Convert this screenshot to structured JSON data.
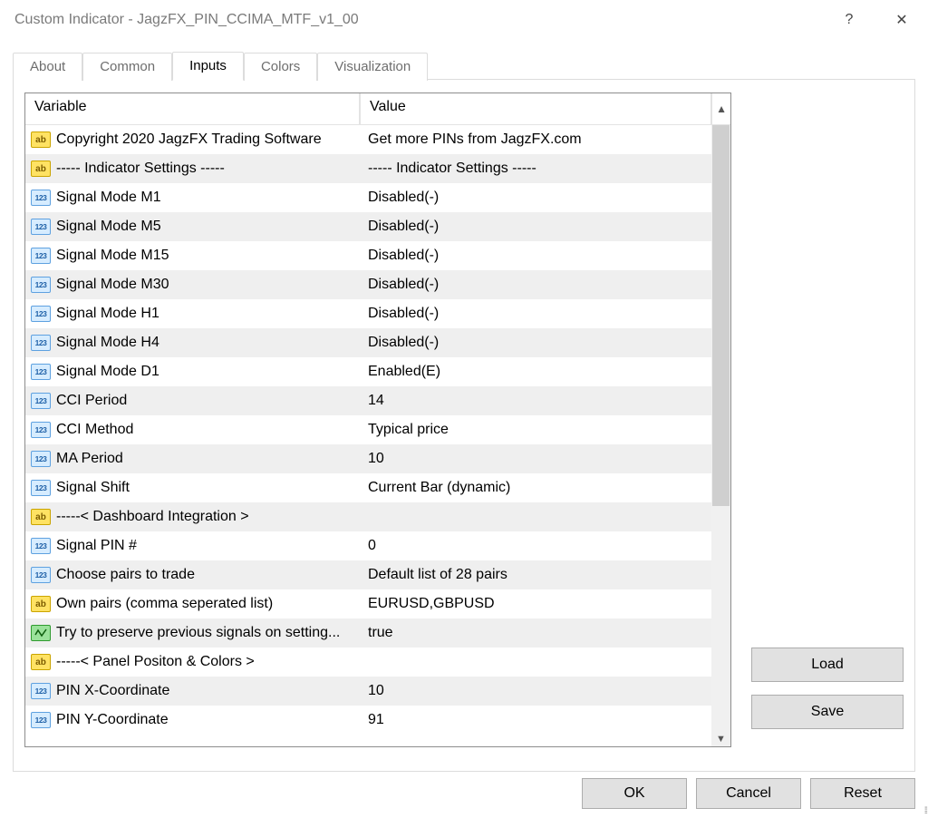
{
  "window": {
    "title": "Custom Indicator - JagzFX_PIN_CCIMA_MTF_v1_00",
    "help_glyph": "?",
    "close_glyph": "✕"
  },
  "tabs": {
    "about": "About",
    "common": "Common",
    "inputs": "Inputs",
    "colors": "Colors",
    "visualization": "Visualization"
  },
  "headers": {
    "variable": "Variable",
    "value": "Value"
  },
  "buttons": {
    "load": "Load",
    "save": "Save",
    "ok": "OK",
    "cancel": "Cancel",
    "reset": "Reset"
  },
  "rows": [
    {
      "icon": "ab",
      "alt": false,
      "variable": "Copyright 2020 JagzFX Trading Software",
      "value": "Get more PINs from JagzFX.com"
    },
    {
      "icon": "ab",
      "alt": true,
      "variable": "----- Indicator Settings  -----",
      "value": "----- Indicator Settings  -----"
    },
    {
      "icon": "123",
      "alt": false,
      "variable": "Signal Mode M1",
      "value": "Disabled(-)"
    },
    {
      "icon": "123",
      "alt": true,
      "variable": "Signal Mode M5",
      "value": "Disabled(-)"
    },
    {
      "icon": "123",
      "alt": false,
      "variable": "Signal Mode M15",
      "value": "Disabled(-)"
    },
    {
      "icon": "123",
      "alt": true,
      "variable": "Signal Mode M30",
      "value": "Disabled(-)"
    },
    {
      "icon": "123",
      "alt": false,
      "variable": "Signal Mode H1",
      "value": "Disabled(-)"
    },
    {
      "icon": "123",
      "alt": true,
      "variable": "Signal Mode H4",
      "value": "Disabled(-)"
    },
    {
      "icon": "123",
      "alt": false,
      "variable": "Signal Mode D1",
      "value": "Enabled(E)"
    },
    {
      "icon": "123",
      "alt": true,
      "variable": "CCI Period",
      "value": "14"
    },
    {
      "icon": "123",
      "alt": false,
      "variable": "CCI Method",
      "value": "Typical price"
    },
    {
      "icon": "123",
      "alt": true,
      "variable": "MA Period",
      "value": "10"
    },
    {
      "icon": "123",
      "alt": false,
      "variable": "Signal Shift",
      "value": "Current Bar (dynamic)"
    },
    {
      "icon": "ab",
      "alt": true,
      "variable": "-----< Dashboard Integration >",
      "value": ""
    },
    {
      "icon": "123",
      "alt": false,
      "variable": "Signal PIN #",
      "value": "0"
    },
    {
      "icon": "123",
      "alt": true,
      "variable": "Choose pairs to trade",
      "value": "Default list of 28 pairs"
    },
    {
      "icon": "ab",
      "alt": false,
      "variable": "Own pairs (comma seperated list)",
      "value": "EURUSD,GBPUSD"
    },
    {
      "icon": "gr",
      "alt": true,
      "variable": "Try to preserve previous signals on setting...",
      "value": "true"
    },
    {
      "icon": "ab",
      "alt": false,
      "variable": "-----< Panel Positon & Colors >",
      "value": ""
    },
    {
      "icon": "123",
      "alt": true,
      "variable": "PIN X-Coordinate",
      "value": "10"
    },
    {
      "icon": "123",
      "alt": false,
      "variable": "PIN Y-Coordinate",
      "value": "91"
    }
  ]
}
